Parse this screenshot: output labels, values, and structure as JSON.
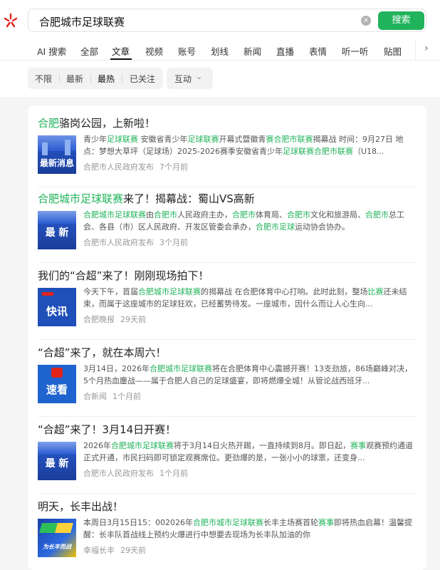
{
  "search": {
    "query": "合肥城市足球联赛",
    "button_label": "搜索",
    "clear_label": "×"
  },
  "tabs": [
    "AI 搜索",
    "全部",
    "文章",
    "视频",
    "账号",
    "划线",
    "新闻",
    "直播",
    "表情",
    "听一听",
    "贴图"
  ],
  "active_tab": "文章",
  "filters": {
    "items": [
      "不限",
      "最新",
      "最热",
      "已关注"
    ],
    "active": "最热",
    "interact_label": "互动"
  },
  "results": [
    {
      "title_segments": [
        {
          "text": "合肥",
          "hl": true
        },
        {
          "text": "骆岗公园，上新啦！",
          "hl": false
        }
      ],
      "thumb": {
        "text": "最新消息",
        "style": "blue-city"
      },
      "snippet_segments": [
        {
          "text": "青少年",
          "hl": false
        },
        {
          "text": "足球联赛",
          "hl": true
        },
        {
          "text": " 安徽省青少年",
          "hl": false
        },
        {
          "text": "足球联赛",
          "hl": true
        },
        {
          "text": "开幕式暨徽青",
          "hl": false
        },
        {
          "text": "赛",
          "hl": true
        },
        {
          "text": "合肥市联赛",
          "hl": true
        },
        {
          "text": "揭幕战 时间：9月27日 地点：梦想大草坪（足球场）2025-2026赛季安徽省青少年",
          "hl": false
        },
        {
          "text": "足球联赛",
          "hl": true
        },
        {
          "text": "合肥市联赛",
          "hl": true
        },
        {
          "text": "（U18...",
          "hl": false
        }
      ],
      "source": "合肥市人民政府发布",
      "time": "7个月前"
    },
    {
      "title_segments": [
        {
          "text": "合肥城市足球联赛",
          "hl": true
        },
        {
          "text": "来了！揭幕战：蜀山VS高新",
          "hl": false
        }
      ],
      "thumb": {
        "text": "最 新",
        "style": "blue-city"
      },
      "snippet_segments": [
        {
          "text": "合肥城市足球联赛",
          "hl": true
        },
        {
          "text": "由",
          "hl": false
        },
        {
          "text": "合肥市",
          "hl": true
        },
        {
          "text": "人民政府主办，",
          "hl": false
        },
        {
          "text": "合肥市",
          "hl": true
        },
        {
          "text": "体育局、",
          "hl": false
        },
        {
          "text": "合肥市",
          "hl": true
        },
        {
          "text": "文化和旅游局、",
          "hl": false
        },
        {
          "text": "合肥市",
          "hl": true
        },
        {
          "text": "总工会、各县（市）区人民政府、开发区管委会承办，",
          "hl": false
        },
        {
          "text": "合肥市足球",
          "hl": true
        },
        {
          "text": "运动协会协办。",
          "hl": false
        }
      ],
      "source": "合肥市人民政府发布",
      "time": "3个月前"
    },
    {
      "title_segments": [
        {
          "text": "我们的“合超”来了！刚刚现场拍下！",
          "hl": false
        }
      ],
      "thumb": {
        "text": "快讯",
        "style": "blue-news"
      },
      "snippet_segments": [
        {
          "text": "今天下午，首届",
          "hl": false
        },
        {
          "text": "合肥城市足球联赛",
          "hl": true
        },
        {
          "text": "的揭幕战 在合肥体育中心打响。此时此刻，整场",
          "hl": false
        },
        {
          "text": "比赛",
          "hl": true
        },
        {
          "text": "还未结束，而属于这座城市的足球狂欢，已经蓄势待发。一座城市，因什么而让人心生向...",
          "hl": false
        }
      ],
      "source": "合肥晚报",
      "time": "29天前"
    },
    {
      "title_segments": [
        {
          "text": "“合超”来了，就在本周六！",
          "hl": false
        }
      ],
      "thumb": {
        "text": "速看",
        "style": "blue-news"
      },
      "snippet_segments": [
        {
          "text": "3月14日，2026年",
          "hl": false
        },
        {
          "text": "合肥城市足球联赛",
          "hl": true
        },
        {
          "text": "将在合肥体育中心震撼开赛！13支劲旅，86场巅峰对决，5个月热血鏖战——属于合肥人自己的足球盛宴，即将燃爆全城！从管论战西班牙...",
          "hl": false
        }
      ],
      "source": "合新闻",
      "time": "1个月前"
    },
    {
      "title_segments": [
        {
          "text": "“合超”来了！3月14日开赛！",
          "hl": false
        }
      ],
      "thumb": {
        "text": "最 新",
        "style": "blue-city"
      },
      "snippet_segments": [
        {
          "text": "2026年",
          "hl": false
        },
        {
          "text": "合肥城市足球联赛",
          "hl": true
        },
        {
          "text": "将于3月14日火热开踢，一直持续到8月。即日起，",
          "hl": false
        },
        {
          "text": "赛事",
          "hl": true
        },
        {
          "text": "观赛预约通道正式开通，市民扫码即可锁定观赛席位。更劲爆的是，一张小小的球票，还变身...",
          "hl": false
        }
      ],
      "source": "合肥市人民政府发布",
      "time": "1个月前"
    },
    {
      "title_segments": [
        {
          "text": "明天，长丰出战！",
          "hl": false
        }
      ],
      "thumb": {
        "text": "为长丰而战",
        "style": "poster"
      },
      "snippet_segments": [
        {
          "text": "本周日3月15日15：002026年",
          "hl": false
        },
        {
          "text": "合肥市城市足球联赛",
          "hl": true
        },
        {
          "text": "长丰主场赛首轮",
          "hl": false
        },
        {
          "text": "赛事",
          "hl": true
        },
        {
          "text": "即将热血启幕！温馨提醒：长丰队首战线上预约火爆进行中想要去现场为长丰队加油的你",
          "hl": false
        }
      ],
      "source": "幸福长丰",
      "time": "29天前"
    }
  ],
  "colors": {
    "accent": "#21b35b",
    "text": "#222222",
    "muted": "#999999",
    "thumb_blue": "#1f4fb8"
  }
}
